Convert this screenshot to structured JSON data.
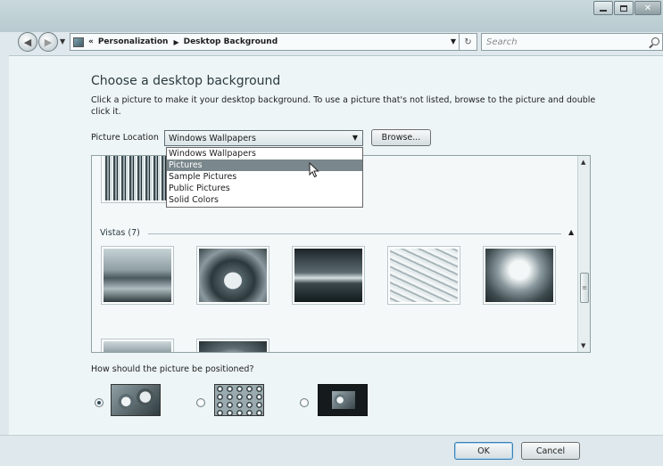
{
  "window": {
    "controls": [
      "minimize",
      "maximize",
      "close"
    ]
  },
  "nav": {
    "breadcrumb_prefix": "«",
    "breadcrumb": [
      "Personalization",
      "Desktop Background"
    ],
    "search_placeholder": "Search"
  },
  "page": {
    "heading": "Choose a desktop background",
    "instructions": "Click a picture to make it your desktop background. To use a picture that's not listed, browse to the picture and double click it.",
    "location_label": "Picture Location",
    "location_value": "Windows Wallpapers",
    "browse_label": "Browse...",
    "location_options": [
      "Windows Wallpapers",
      "Pictures",
      "Sample Pictures",
      "Public Pictures",
      "Solid Colors"
    ],
    "selected_option_index": 1,
    "group_label": "Vistas (7)",
    "position_question": "How should the picture be positioned?",
    "position_options": [
      "Fill",
      "Tile",
      "Center"
    ],
    "selected_position_index": 0
  },
  "footer": {
    "ok_label": "OK",
    "cancel_label": "Cancel"
  },
  "colors": {
    "accent": "#7a878c",
    "window_bg": "#dfe8ec",
    "content_bg": "#eef5f6"
  }
}
